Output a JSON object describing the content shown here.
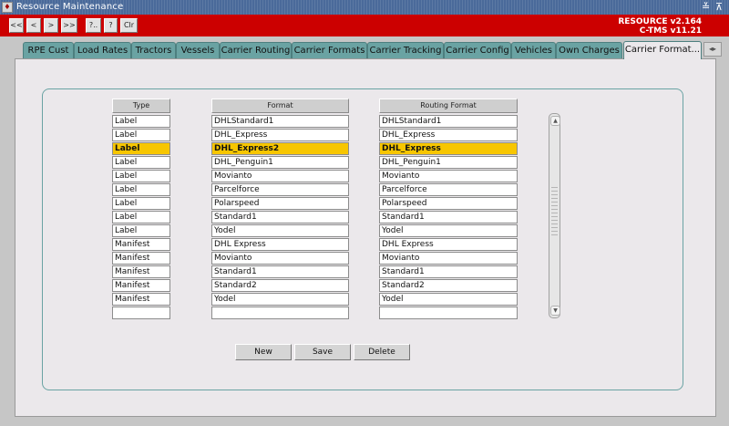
{
  "window": {
    "title": "Resource Maintenance",
    "app_icon": "app-icon",
    "min_glyph": "≚",
    "max_glyph": "⊼"
  },
  "toolbar": {
    "buttons": [
      "<<",
      "<",
      ">",
      ">>",
      "?..",
      "?",
      "Clr"
    ],
    "brand_line1": "RESOURCE v2.164",
    "brand_line2": "C-TMS v11.21"
  },
  "tabs": [
    "RPE Cust",
    "Load Rates",
    "Tractors",
    "Vessels",
    "Carrier Routing",
    "Carrier Formats",
    "Carrier Tracking",
    "Carrier Config",
    "Vehicles",
    "Own Charges",
    "Carrier Format..."
  ],
  "active_tab": "Carrier Format...",
  "grid": {
    "headers": {
      "type": "Type",
      "format": "Format",
      "routing_format": "Routing Format"
    },
    "selected_row": 2,
    "rows": [
      {
        "type": "Label",
        "format": "DHLStandard1",
        "routing_format": "DHLStandard1"
      },
      {
        "type": "Label",
        "format": "DHL_Express",
        "routing_format": "DHL_Express"
      },
      {
        "type": "Label",
        "format": "DHL_Express2",
        "routing_format": "DHL_Express"
      },
      {
        "type": "Label",
        "format": "DHL_Penguin1",
        "routing_format": "DHL_Penguin1"
      },
      {
        "type": "Label",
        "format": "Movianto",
        "routing_format": "Movianto"
      },
      {
        "type": "Label",
        "format": "Parcelforce",
        "routing_format": "Parcelforce"
      },
      {
        "type": "Label",
        "format": "Polarspeed",
        "routing_format": "Polarspeed"
      },
      {
        "type": "Label",
        "format": "Standard1",
        "routing_format": "Standard1"
      },
      {
        "type": "Label",
        "format": "Yodel",
        "routing_format": "Yodel"
      },
      {
        "type": "Manifest",
        "format": "DHL Express",
        "routing_format": "DHL Express"
      },
      {
        "type": "Manifest",
        "format": "Movianto",
        "routing_format": "Movianto"
      },
      {
        "type": "Manifest",
        "format": "Standard1",
        "routing_format": "Standard1"
      },
      {
        "type": "Manifest",
        "format": "Standard2",
        "routing_format": "Standard2"
      },
      {
        "type": "Manifest",
        "format": "Yodel",
        "routing_format": "Yodel"
      },
      {
        "type": "",
        "format": "",
        "routing_format": ""
      }
    ]
  },
  "actions": {
    "new": "New",
    "save": "Save",
    "delete": "Delete"
  },
  "colors": {
    "toolbar": "#cc0000",
    "tab": "#6aa3a3",
    "selected_row": "#f7c600",
    "panel": "#ebe8eb"
  }
}
